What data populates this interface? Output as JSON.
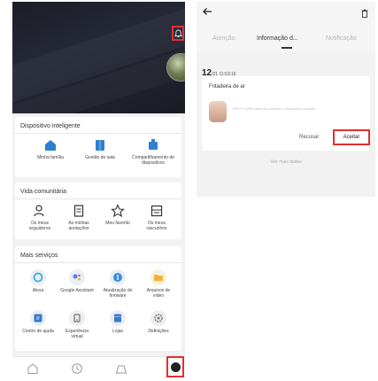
{
  "left": {
    "smart_devices": {
      "title": "Dispositivo inteligente",
      "items": [
        {
          "label": "Minha família",
          "icon": "home-icon"
        },
        {
          "label": "Gestão de sala",
          "icon": "room-icon"
        },
        {
          "label": "Compartilhamento de dispositivos",
          "icon": "share-device-icon"
        }
      ]
    },
    "community": {
      "title": "Vida comunitária",
      "items": [
        {
          "label": "Os meus seguidores",
          "icon": "followers-icon"
        },
        {
          "label": "As minhas anotações",
          "icon": "notes-icon"
        },
        {
          "label": "Meu favorito",
          "icon": "star-icon"
        },
        {
          "label": "Os meus rascunhos",
          "icon": "drafts-icon"
        }
      ]
    },
    "services": {
      "title": "Mais serviços",
      "items": [
        {
          "label": "Alexa",
          "icon": "alexa-icon"
        },
        {
          "label": "Google Assistant",
          "icon": "google-assistant-icon"
        },
        {
          "label": "Atualização do firmware",
          "icon": "firmware-icon"
        },
        {
          "label": "Arquivos de vídeo",
          "icon": "video-folder-icon"
        },
        {
          "label": "Centro de ajuda",
          "icon": "help-icon"
        },
        {
          "label": "Experiência virtual",
          "icon": "virtual-icon"
        },
        {
          "label": "Lojas",
          "icon": "store-icon"
        },
        {
          "label": "Definições",
          "icon": "settings-icon"
        }
      ]
    }
  },
  "right": {
    "tabs": [
      "Atenção",
      "Informação d...",
      "Notificação"
    ],
    "active_tab": "Informação d...",
    "date_day": "12",
    "date_rest": "/21  11:53:16",
    "message": {
      "title": "Fritadeira de ar",
      "body": "138*****2286 pretende partilhar o dispositivo consigo",
      "decline": "Recusar",
      "accept": "Aceitar"
    },
    "see_more": "Veir mais dados"
  },
  "colors": {
    "highlight": "#e03030",
    "header_dark": "#1f2230",
    "accent_blue": "#2f7fd1",
    "background": "#f2f2f2"
  }
}
